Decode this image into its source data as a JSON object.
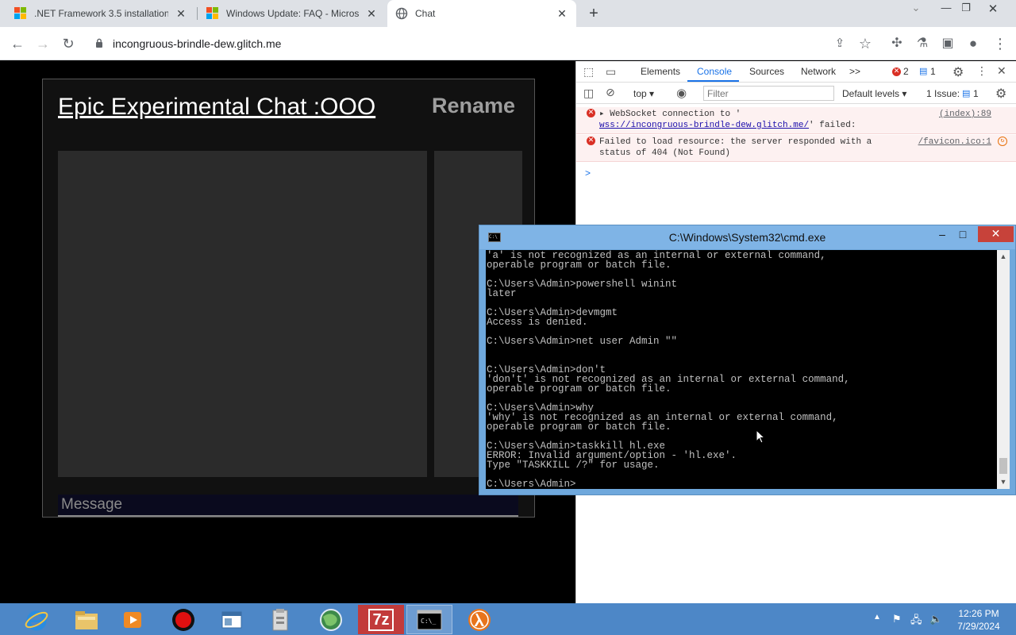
{
  "browser": {
    "tabs": [
      {
        "title": ".NET Framework 3.5 installation",
        "icon": "microsoft-logo"
      },
      {
        "title": "Windows Update: FAQ - Microso",
        "icon": "microsoft-logo"
      },
      {
        "title": "Chat",
        "icon": "globe-icon",
        "active": true
      }
    ],
    "new_tab": "+",
    "address": "incongruous-brindle-dew.glitch.me"
  },
  "chat": {
    "title": "Epic Experimental Chat :OOO",
    "rename_label": "Rename",
    "message_placeholder": "Message"
  },
  "devtools": {
    "tabs": [
      "Elements",
      "Console",
      "Sources",
      "Network"
    ],
    "active_tab": "Console",
    "more_tabs": ">>",
    "error_count": "2",
    "message_count": "1",
    "context": "top",
    "filter_placeholder": "Filter",
    "levels": "Default levels",
    "issues_label": "1 Issue:",
    "issues_count": "1",
    "console": [
      {
        "line1": "WebSocket connection to '",
        "link": "wss://incongruous-brindle-dew.glitch.me/",
        "line2_suffix": "' failed:",
        "source": "(index):89"
      },
      {
        "line1": "Failed to load resource: the server responded with a",
        "line2": "status of 404 (Not Found)",
        "source": "/favicon.ico:1"
      }
    ],
    "prompt": ">"
  },
  "cmd": {
    "title": "C:\\Windows\\System32\\cmd.exe",
    "lines": [
      "'a' is not recognized as an internal or external command,",
      "operable program or batch file.",
      "",
      "C:\\Users\\Admin>powershell winint",
      "later",
      "",
      "C:\\Users\\Admin>devmgmt",
      "Access is denied.",
      "",
      "C:\\Users\\Admin>net user Admin \"\"",
      "",
      "",
      "C:\\Users\\Admin>don't",
      "'don't' is not recognized as an internal or external command,",
      "operable program or batch file.",
      "",
      "C:\\Users\\Admin>why",
      "'why' is not recognized as an internal or external command,",
      "operable program or batch file.",
      "",
      "C:\\Users\\Admin>taskkill hl.exe",
      "ERROR: Invalid argument/option - 'hl.exe'.",
      "Type \"TASKKILL /?\" for usage.",
      "",
      "C:\\Users\\Admin>"
    ]
  },
  "taskbar": {
    "apps": [
      "internet-explorer",
      "file-explorer",
      "media-player",
      "record-app",
      "window-app",
      "archive-app",
      "globe-app",
      "7zip",
      "cmd",
      "half-life"
    ],
    "active_app": "cmd",
    "time": "12:26 PM",
    "date": "7/29/2024"
  },
  "colors": {
    "cmd_title_bar": "#7fb4e6",
    "cmd_close": "#c7423a",
    "taskbar": "#4d87c7",
    "devtools_accent": "#1a73e8",
    "error_red": "#d93025"
  }
}
